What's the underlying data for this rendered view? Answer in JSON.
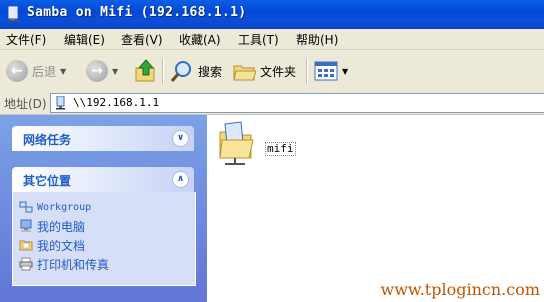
{
  "window": {
    "title": "Samba on Mifi (192.168.1.1)"
  },
  "menu": {
    "items": [
      "文件(F)",
      "编辑(E)",
      "查看(V)",
      "收藏(A)",
      "工具(T)",
      "帮助(H)"
    ]
  },
  "toolbar": {
    "back_label": "后退",
    "search_label": "搜索",
    "folders_label": "文件夹"
  },
  "address": {
    "label": "地址(D)",
    "value": "\\\\192.168.1.1"
  },
  "tasks": {
    "network_tasks": {
      "title": "网络任务"
    },
    "other_places": {
      "title": "其它位置",
      "links": [
        "Workgroup",
        "我的电脑",
        "我的文档",
        "打印机和传真"
      ]
    }
  },
  "content": {
    "items": [
      {
        "name": "mifi"
      }
    ]
  },
  "watermark": "www.tplogincn.com",
  "colors": {
    "title_blue": "#0a4fd9",
    "task_link": "#215dc6",
    "pane_bg": "#7ba2e7",
    "watermark": "#c25500"
  }
}
